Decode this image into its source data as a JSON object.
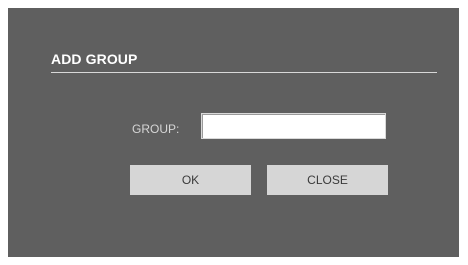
{
  "dialog": {
    "title": "ADD GROUP",
    "group_label": "GROUP:",
    "group_value": "",
    "ok_label": "OK",
    "close_label": "CLOSE"
  },
  "colors": {
    "dialog_background": "#5f5f5f",
    "button_background": "#d6d6d6",
    "title_text": "#ffffff"
  }
}
